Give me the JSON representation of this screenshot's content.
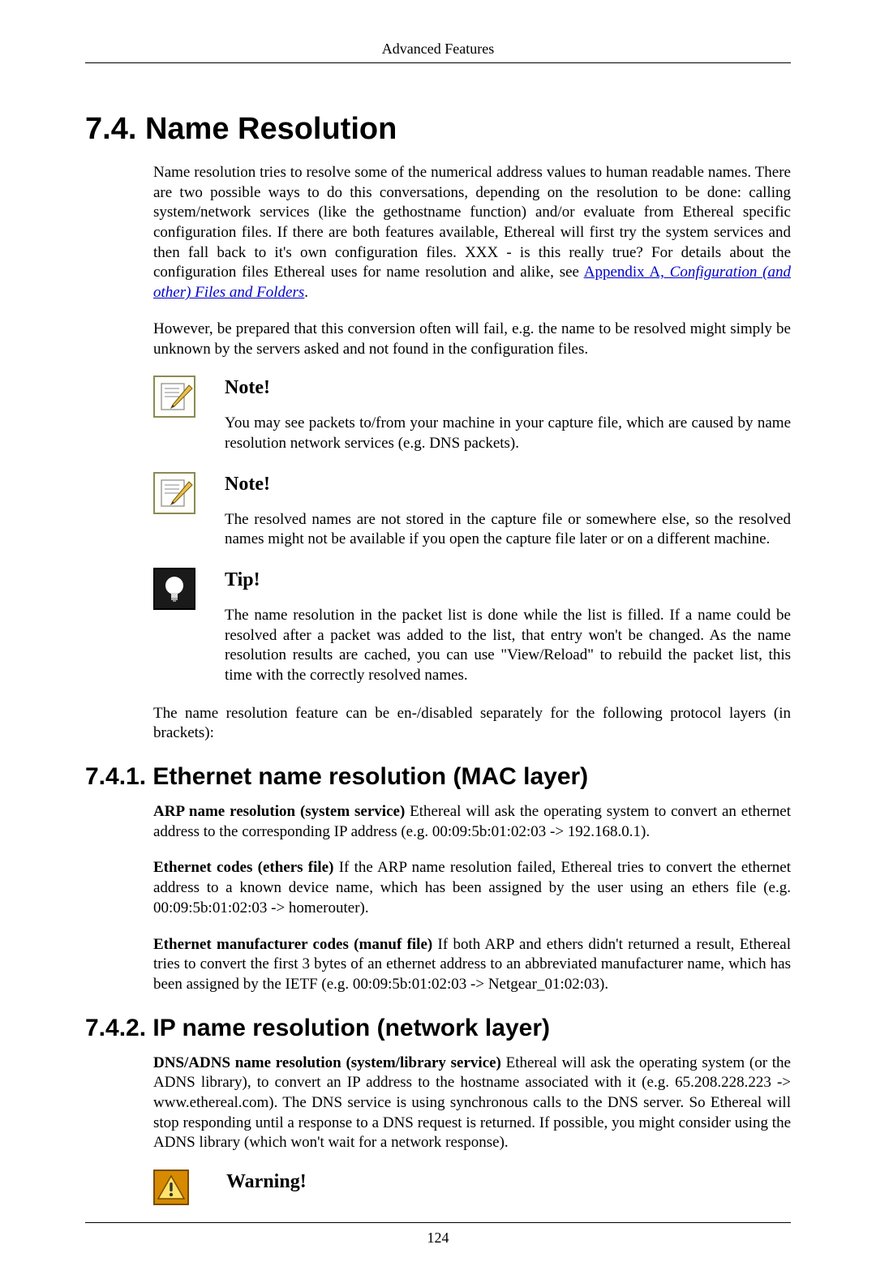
{
  "header": {
    "running": "Advanced Features"
  },
  "section": {
    "number": "7.4.",
    "title": "Name Resolution",
    "intro1_a": "Name resolution tries to resolve some of the numerical address values to human readable names. There are two possible ways to do this conversations, depending on the resolution to be done: calling system/network services (like the gethostname function) and/or evaluate from Ethereal specific configuration files. If there are both features available, Ethereal will first try the system services and then fall back to it's own configuration files. XXX - is this really true? For details about the configuration files Ethereal uses for name resolution and alike, see ",
    "intro1_link_prefix": "Appendix A, ",
    "intro1_link": "Configuration (and other) Files and Folders",
    "intro1_b": ".",
    "intro2": "However, be prepared that this conversion often will fail, e.g. the name to be resolved might simply be unknown by the servers asked and not found in the configuration files.",
    "note1_title": "Note!",
    "note1_body": "You may see packets to/from your machine in your capture file, which are caused by name resolution network services (e.g. DNS packets).",
    "note2_title": "Note!",
    "note2_body": "The resolved names are not stored in the capture file or somewhere else, so the resolved names might not be available if you open the capture file later or on a different machine.",
    "tip_title": "Tip!",
    "tip_body": "The name resolution in the packet list is done while the list is filled. If a name could be resolved after a packet was added to the list, that entry won't be changed. As the name resolution results are cached, you can use \"View/Reload\" to rebuild the packet list, this time with the correctly resolved names.",
    "intro3": "The name resolution feature can be en-/disabled separately for the following protocol layers (in brackets):"
  },
  "sub1": {
    "number": "7.4.1.",
    "title": "Ethernet name resolution (MAC layer)",
    "p1_bold": "ARP name resolution (system service)",
    "p1_rest": " Ethereal will ask the operating system to convert an ethernet address to the corresponding IP address (e.g. 00:09:5b:01:02:03 -> 192.168.0.1).",
    "p2_bold": "Ethernet codes (ethers file)",
    "p2_rest": " If the ARP name resolution failed, Ethereal tries to convert the ethernet address to a known device name, which has been assigned by the user using an ethers file (e.g. 00:09:5b:01:02:03 -> homerouter).",
    "p3_bold": "Ethernet manufacturer codes (manuf file)",
    "p3_rest": " If both ARP and ethers didn't returned a result, Ethereal tries to convert the first 3 bytes of an ethernet address to an abbreviated manufacturer name, which has been assigned by the IETF (e.g. 00:09:5b:01:02:03 -> Netgear_01:02:03)."
  },
  "sub2": {
    "number": "7.4.2.",
    "title": "IP name resolution (network layer)",
    "p1_bold": "DNS/ADNS name resolution (system/library service)",
    "p1_rest": " Ethereal will ask the operating system (or the ADNS library), to convert an IP address to the hostname associated with it (e.g. 65.208.228.223 -> www.ethereal.com). The DNS service is using synchronous calls to the DNS server. So Ethereal will stop responding until a response to a DNS request is returned. If possible, you might consider using the ADNS library (which won't wait for a network response).",
    "warn_title": "Warning!"
  },
  "footer": {
    "page": "124"
  }
}
